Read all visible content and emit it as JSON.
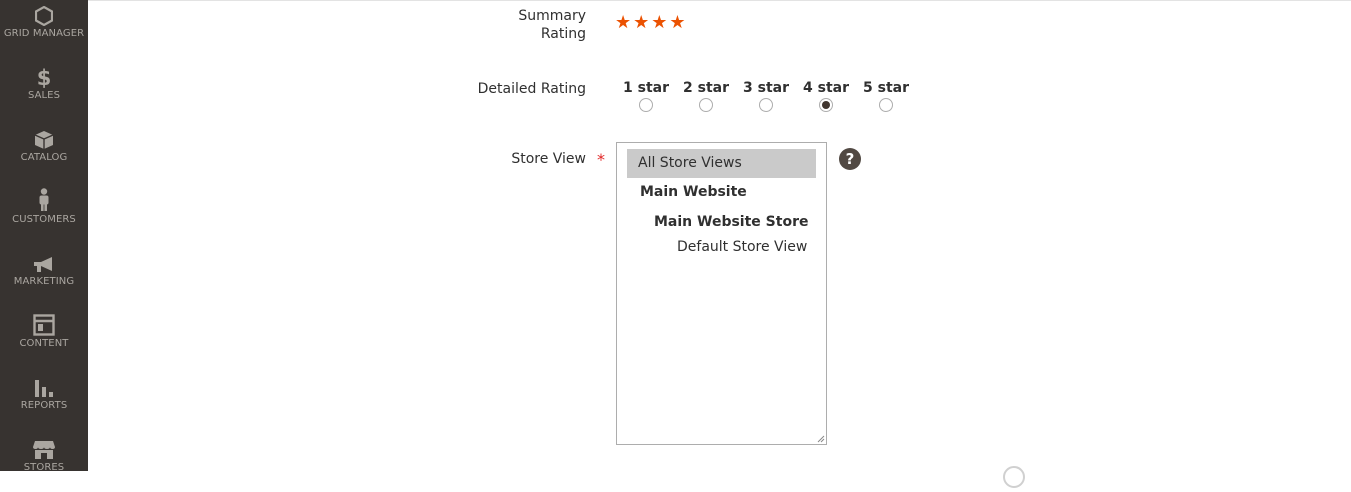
{
  "sidebar": {
    "items": [
      {
        "label": "GRID MANAGER",
        "icon": "hexagon-icon"
      },
      {
        "label": "SALES",
        "icon": "dollar-icon"
      },
      {
        "label": "CATALOG",
        "icon": "box-icon"
      },
      {
        "label": "CUSTOMERS",
        "icon": "person-icon"
      },
      {
        "label": "MARKETING",
        "icon": "megaphone-icon"
      },
      {
        "label": "CONTENT",
        "icon": "layout-icon"
      },
      {
        "label": "REPORTS",
        "icon": "bar-chart-icon"
      },
      {
        "label": "STORES",
        "icon": "storefront-icon"
      }
    ],
    "background": "#373330"
  },
  "form": {
    "summary_rating": {
      "label": "Summary Rating",
      "label_line1": "Summary",
      "label_line2": "Rating",
      "stars_text": "★★★★",
      "value": 4,
      "max": 5
    },
    "detailed_rating": {
      "label": "Detailed Rating",
      "options": [
        "1 star",
        "2 star",
        "3 star",
        "4 star",
        "5 star"
      ],
      "selected_index": 3
    },
    "store_view": {
      "label": "Store View",
      "required_mark": "*",
      "options": [
        {
          "text": "All Store Views",
          "selected": true
        },
        {
          "text": "Main Website",
          "bold": true
        },
        {
          "text": "Main Website Store",
          "bold": true
        },
        {
          "text": "Default Store View"
        }
      ],
      "help": "?"
    }
  },
  "colors": {
    "star": "#eb5202",
    "required": "#e22626",
    "selected_option_bg": "#cacaca"
  }
}
